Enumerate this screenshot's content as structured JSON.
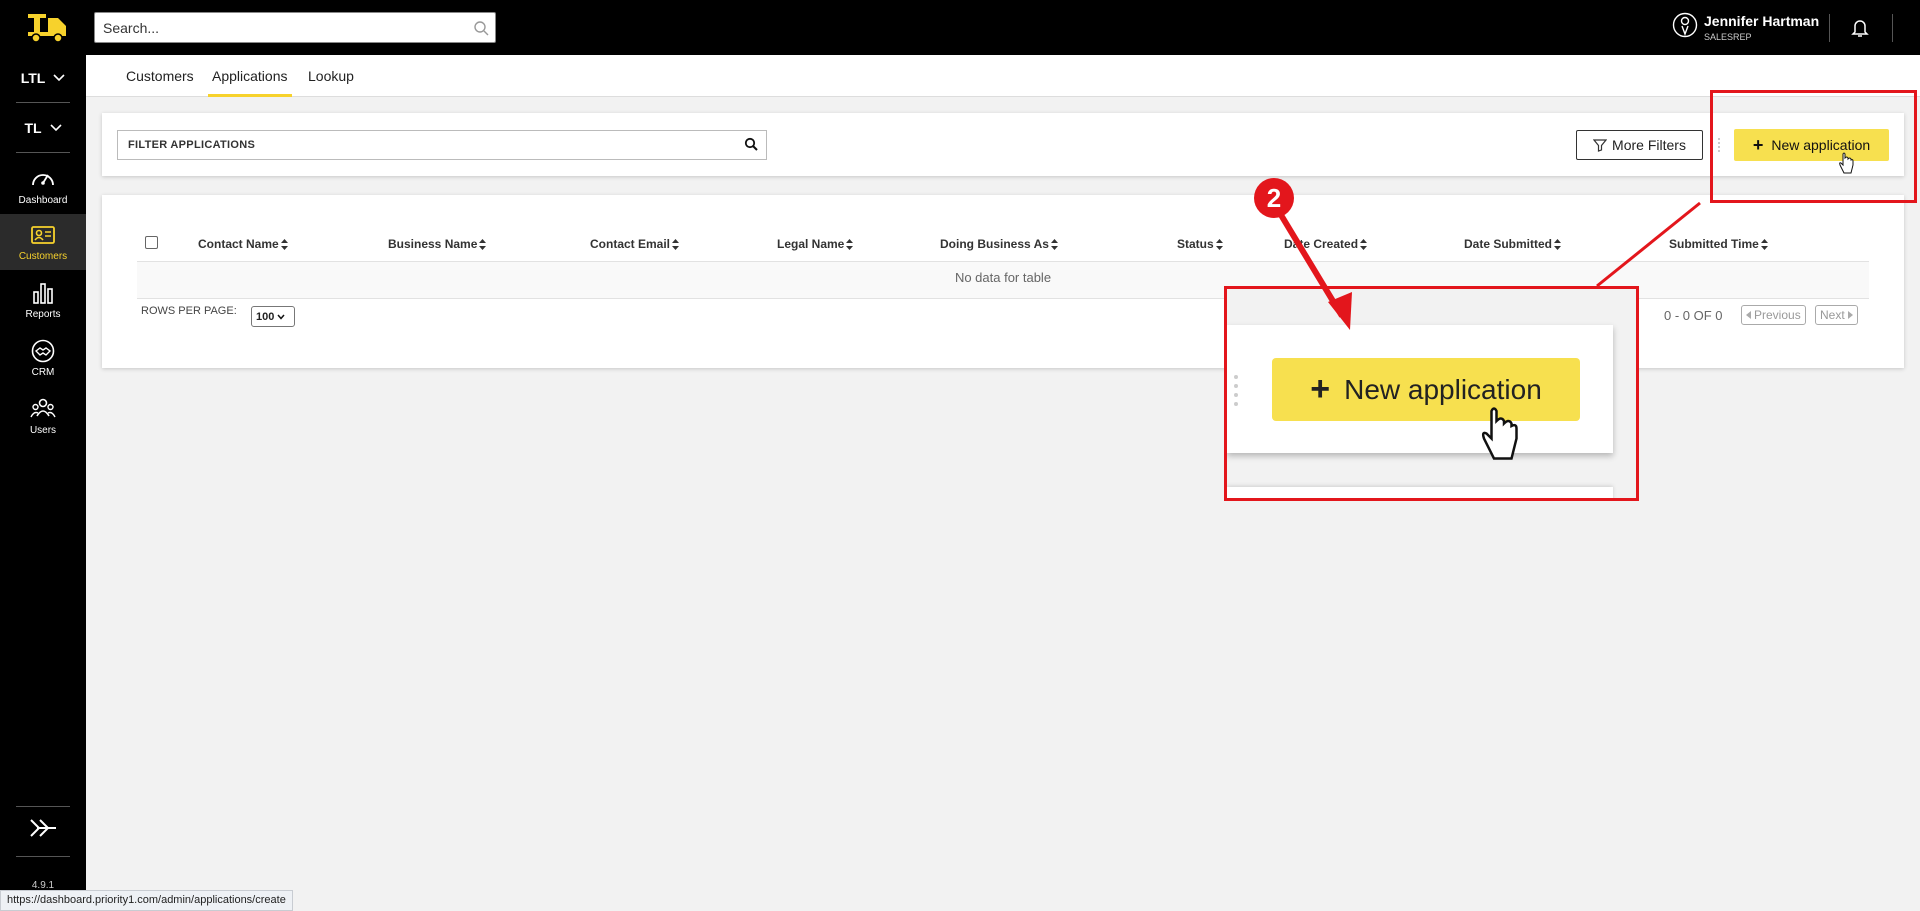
{
  "sidebar": {
    "dropdowns": [
      {
        "label": "LTL"
      },
      {
        "label": "TL"
      }
    ],
    "items": [
      {
        "label": "Dashboard",
        "icon": "dashboard-gauge-icon"
      },
      {
        "label": "Customers",
        "icon": "customers-card-icon",
        "active": true
      },
      {
        "label": "Reports",
        "icon": "reports-bar-icon"
      },
      {
        "label": "CRM",
        "icon": "crm-handshake-icon"
      },
      {
        "label": "Users",
        "icon": "users-group-icon"
      }
    ],
    "version": "4.9.1"
  },
  "topbar": {
    "search_placeholder": "Search...",
    "user": {
      "name": "Jennifer Hartman",
      "role": "SALESREP"
    }
  },
  "tabs": [
    {
      "label": "Customers"
    },
    {
      "label": "Applications",
      "active": true
    },
    {
      "label": "Lookup"
    }
  ],
  "filter": {
    "placeholder": "FILTER APPLICATIONS",
    "more_filters_label": "More Filters",
    "new_application_label": "New application"
  },
  "table": {
    "columns": [
      "Contact Name",
      "Business Name",
      "Contact Email",
      "Legal Name",
      "Doing Business As",
      "Status",
      "Date Created",
      "Date Submitted",
      "Submitted Time"
    ],
    "empty_message": "No data for table",
    "rows_per_page_label": "ROWS PER PAGE:",
    "rows_per_page_value": "100",
    "pager_info": "0 - 0 OF 0",
    "previous_label": "Previous",
    "next_label": "Next"
  },
  "annotation": {
    "step_number": "2",
    "zoom_button_label": "New application"
  },
  "status_bar": {
    "url": "https://dashboard.priority1.com/admin/applications/create"
  },
  "colors": {
    "accent": "#f7d22c",
    "button": "#f7e04f",
    "annotation": "#e3161c",
    "sidebar_bg": "#000000"
  }
}
